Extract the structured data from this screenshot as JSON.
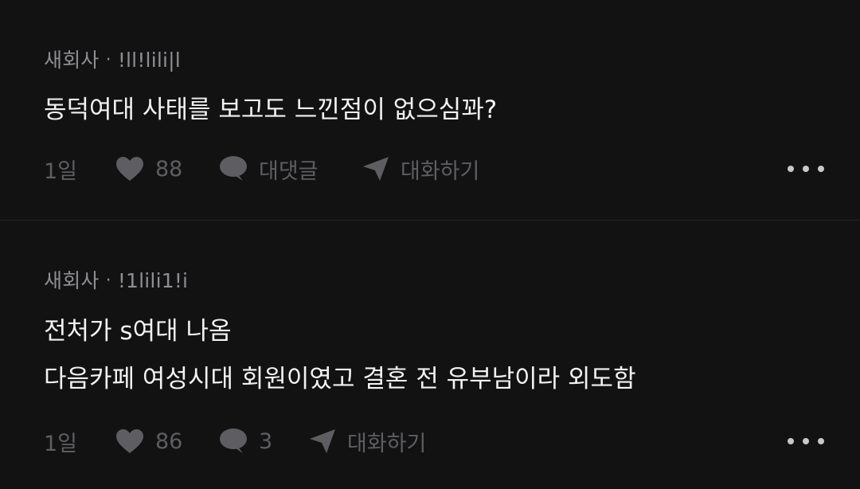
{
  "comments": [
    {
      "author": "새회사",
      "separator": "·",
      "user_id": "!ll!lili|l",
      "lines": [
        "동덕여대 사태를 보고도 느낀점이 없으심꽈?"
      ],
      "time": "1일",
      "likes": "88",
      "reply_label": "대댓글",
      "chat_label": "대화하기"
    },
    {
      "author": "새회사",
      "separator": "·",
      "user_id": "!1lili1!i",
      "lines": [
        "전처가 s여대 나옴",
        "다음카페 여성시대 회원이였고 결혼 전 유부남이라 외도함"
      ],
      "time": "1일",
      "likes": "86",
      "reply_count": "3",
      "chat_label": "대화하기"
    }
  ],
  "colors": {
    "background": "#121213",
    "primary_text": "#f2f2f2",
    "meta_text": "#8e8e93",
    "action_text": "#5e5e62",
    "more_dots": "#c8c8cc"
  },
  "icons": {
    "like": "heart-icon",
    "reply": "speech-bubble-icon",
    "chat": "paper-plane-icon",
    "more": "more-dots-icon"
  }
}
